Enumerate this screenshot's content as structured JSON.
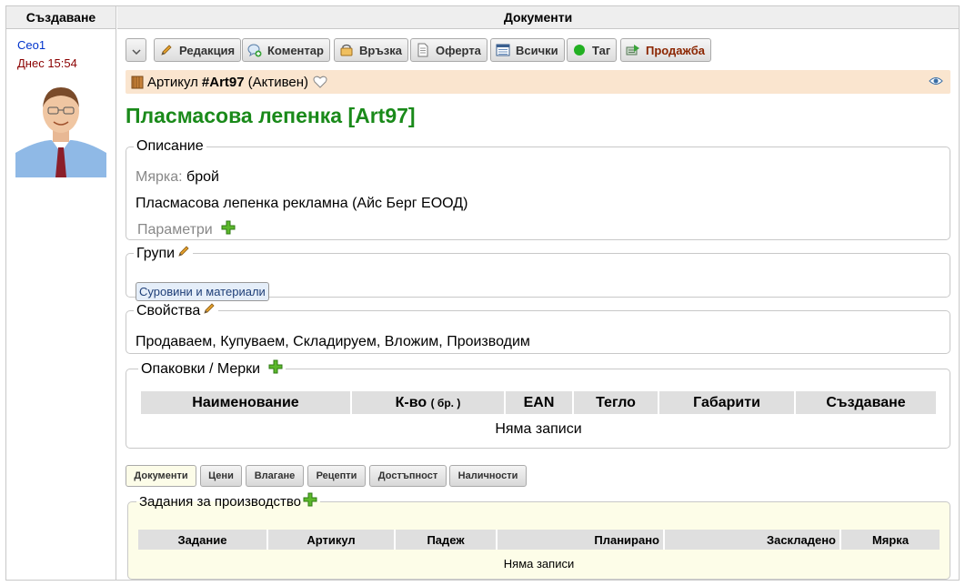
{
  "left_column": {
    "header": "Създаване",
    "author": "Ceo1",
    "created": "Днес 15:54"
  },
  "right_column": {
    "header": "Документи"
  },
  "toolbar": {
    "edit": "Редакция",
    "comment": "Коментар",
    "link": "Връзка",
    "offer": "Оферта",
    "all": "Всички",
    "tag": "Таг",
    "sale": "Продажба"
  },
  "record": {
    "type": "Артикул",
    "number": "#Art97",
    "state": "(Активен)",
    "title": "Пласмасова лепенка [Art97]"
  },
  "description": {
    "legend": "Описание",
    "measure_label": "Мярка:",
    "measure_value": "брой",
    "text": "Пласмасова лепенка рекламна (Айс Берг ЕООД)",
    "params_label": "Параметри"
  },
  "groups": {
    "legend": "Групи",
    "items": [
      "Суровини и материали"
    ]
  },
  "properties": {
    "legend": "Свойства",
    "text": "Продаваем, Купуваем, Складируем, Вложим, Производим"
  },
  "packaging": {
    "legend": "Опаковки / Мерки",
    "columns": [
      "Наименование",
      "К-во",
      "EAN",
      "Тегло",
      "Габарити",
      "Създаване"
    ],
    "qty_unit": "( бр. )",
    "empty": "Няма записи"
  },
  "tabs": [
    "Документи",
    "Цени",
    "Влагане",
    "Рецепти",
    "Достъпност",
    "Наличности"
  ],
  "production": {
    "legend": "Задания за производство",
    "columns": [
      "Задание",
      "Артикул",
      "Падеж",
      "Планирано",
      "Заскладено",
      "Мярка"
    ],
    "empty": "Няма записи"
  },
  "colors": {
    "title_green": "#1a8a1a",
    "infobar_bg": "#fae5cf",
    "author_blue": "#0033cc",
    "date_red": "#8b0000"
  }
}
